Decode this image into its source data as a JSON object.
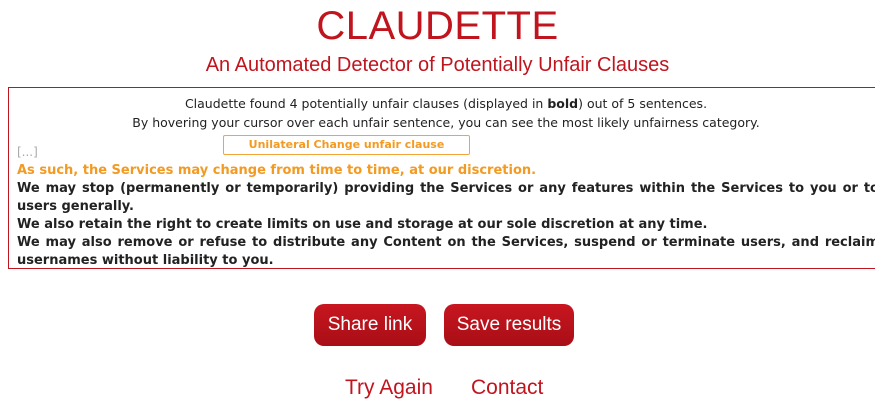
{
  "header": {
    "title": "CLAUDETTE",
    "subtitle": "An Automated Detector of Potentially Unfair Clauses"
  },
  "result": {
    "summary_prefix": "Claudette found 4 potentially unfair clauses (displayed in ",
    "summary_bold": "bold",
    "summary_suffix": ") out of 5 sentences.",
    "hint": "By hovering your cursor over each unfair sentence, you can see the most likely unfairness category.",
    "tooltip": "Unilateral Change unfair clause",
    "ellipsis": "[...]",
    "sentences": [
      {
        "text": "As such, the Services may change from time to time, at our discretion.",
        "highlighted": true
      },
      {
        "text": "We may stop (permanently or temporarily) providing the Services or any features within the Services to you or to users generally.",
        "highlighted": false
      },
      {
        "text": "We also retain the right to create limits on use and storage at our sole discretion at any time.",
        "highlighted": false
      },
      {
        "text": "We may also remove or refuse to distribute any Content on the Services, suspend or terminate users, and reclaim usernames without liability to you.",
        "highlighted": false
      }
    ]
  },
  "actions": {
    "share_label": "Share link",
    "save_label": "Save results"
  },
  "footer": {
    "try_again": "Try Again",
    "contact": "Contact"
  },
  "colors": {
    "brand": "#c0141e",
    "highlight": "#f39a22"
  }
}
